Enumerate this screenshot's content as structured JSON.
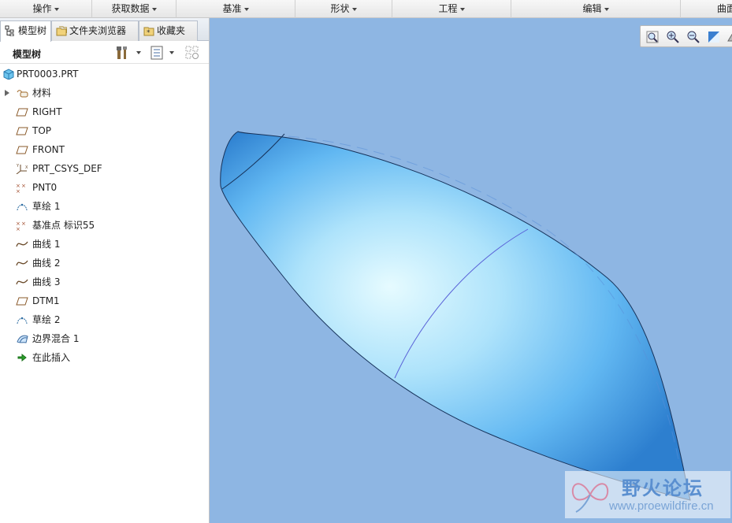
{
  "menu": [
    {
      "label": "操作",
      "has_caret": true
    },
    {
      "label": "获取数据",
      "has_caret": true
    },
    {
      "label": "基准",
      "has_caret": true
    },
    {
      "label": "形状",
      "has_caret": true
    },
    {
      "label": "工程",
      "has_caret": true
    },
    {
      "label": "编辑",
      "has_caret": true
    },
    {
      "label": "曲面",
      "has_caret": false
    }
  ],
  "tabs": [
    {
      "label": "模型树",
      "icon": "model-tree-icon",
      "active": true
    },
    {
      "label": "文件夹浏览器",
      "icon": "folder-browser-icon",
      "active": false
    },
    {
      "label": "收藏夹",
      "icon": "favorites-icon",
      "active": false
    }
  ],
  "tree_toolbar": {
    "title": "模型树",
    "buttons": [
      "settings-icon",
      "show-icon",
      "filter-icon"
    ]
  },
  "tree": [
    {
      "label": "PRT0003.PRT",
      "icon": "part-icon",
      "expandable": false
    },
    {
      "label": "材料",
      "icon": "material-icon",
      "expandable": true
    },
    {
      "label": "RIGHT",
      "icon": "datum-plane-icon",
      "expandable": false
    },
    {
      "label": "TOP",
      "icon": "datum-plane-icon",
      "expandable": false
    },
    {
      "label": "FRONT",
      "icon": "datum-plane-icon",
      "expandable": false
    },
    {
      "label": "PRT_CSYS_DEF",
      "icon": "coordinate-system-icon",
      "expandable": false
    },
    {
      "label": "PNT0",
      "icon": "datum-point-icon",
      "expandable": false
    },
    {
      "label": "草绘 1",
      "icon": "sketch-icon",
      "expandable": false
    },
    {
      "label": "基准点 标识55",
      "icon": "datum-point-icon",
      "expandable": false
    },
    {
      "label": "曲线 1",
      "icon": "curve-icon",
      "expandable": false
    },
    {
      "label": "曲线 2",
      "icon": "curve-icon",
      "expandable": false
    },
    {
      "label": "曲线 3",
      "icon": "curve-icon",
      "expandable": false
    },
    {
      "label": "DTM1",
      "icon": "datum-plane-icon",
      "expandable": false
    },
    {
      "label": "草绘 2",
      "icon": "sketch-icon",
      "expandable": false
    },
    {
      "label": "边界混合 1",
      "icon": "boundary-blend-icon",
      "expandable": false
    },
    {
      "label": "在此插入",
      "icon": "insert-here-arrow-icon",
      "expandable": false
    }
  ],
  "view_toolbar": [
    "zoom-fit-icon",
    "zoom-in-icon",
    "zoom-out-icon",
    "repaint-icon",
    "orient-icon"
  ],
  "colors": {
    "viewport_bg": "#8eb6e3",
    "surface_light": "#e6fbff",
    "surface_mid": "#62b8f2",
    "surface_dark": "#2d7fcf"
  },
  "watermark": {
    "title": "野火论坛",
    "url": "www.proewildfire.cn"
  }
}
